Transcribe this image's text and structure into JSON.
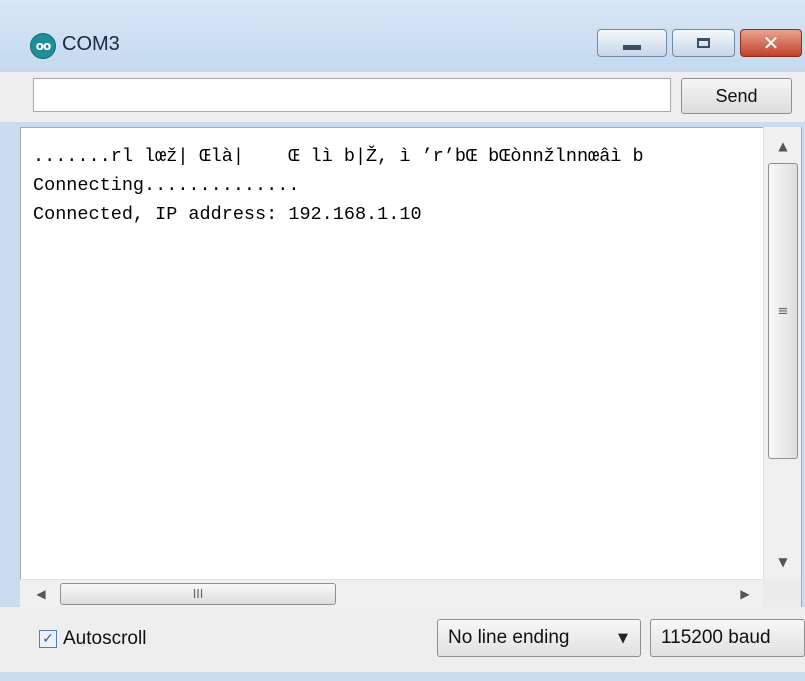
{
  "window": {
    "title": "COM3",
    "app_icon": "arduino-icon",
    "controls": {
      "minimize_icon": "minimize-icon",
      "maximize_icon": "maximize-icon",
      "close_icon": "close-icon"
    }
  },
  "send": {
    "input_value": "",
    "button_label": "Send"
  },
  "output": {
    "lines": [
      ".......rl lœž| Œlà|    Œ lì b|Ž, ì ’r’bŒ bŒònnžlnnœâì b",
      "Connecting..............",
      "Connected, IP address: 192.168.1.10"
    ]
  },
  "scrollbars": {
    "up_arrow": "▲",
    "down_arrow": "▼",
    "left_arrow": "◀",
    "right_arrow": "▶",
    "vthumb_grip": "≡",
    "hthumb_grip": "III"
  },
  "footer": {
    "autoscroll_label": "Autoscroll",
    "autoscroll_checked": true,
    "line_ending": "No line ending",
    "baud": "115200 baud"
  }
}
